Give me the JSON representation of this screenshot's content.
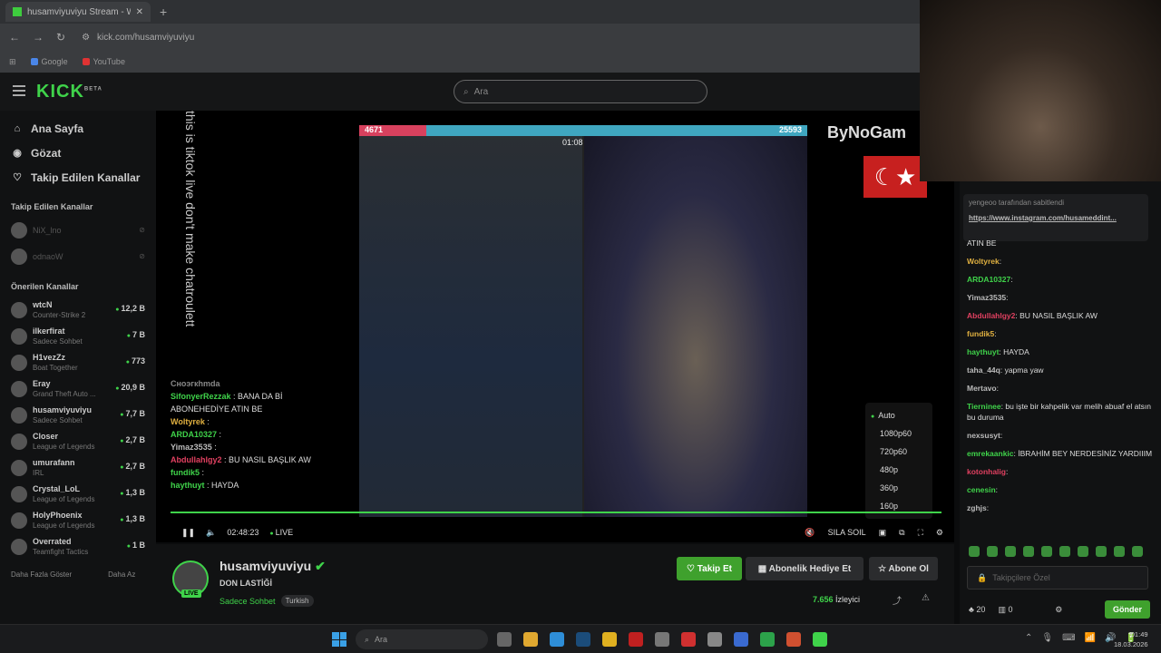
{
  "browser": {
    "tab_title": "husamviyuviyu Stream - W",
    "tab_close": "✕",
    "new_tab": "+",
    "back": "←",
    "forward": "→",
    "reload": "↻",
    "url": "kick.com/husamviyuviyu",
    "apps": "⊞",
    "bookmarks": [
      {
        "label": "Google",
        "color": "#4a86e8"
      },
      {
        "label": "YouTube",
        "color": "#e03333"
      }
    ]
  },
  "header": {
    "logo": "KICK",
    "beta": "BETA",
    "search_icon": "⌕",
    "search_placeholder": "Ara"
  },
  "sidebar": {
    "nav": [
      {
        "icon": "⌂",
        "label": "Ana Sayfa"
      },
      {
        "icon": "◉",
        "label": "Gözat"
      },
      {
        "icon": "♡",
        "label": "Takip Edilen Kanallar"
      }
    ],
    "followed_title": "Takip Edilen Kanallar",
    "followed": [
      {
        "name": "NiX_lno",
        "mute": "⊘"
      },
      {
        "name": "odnaoW",
        "mute": "⊘"
      }
    ],
    "recommended_title": "Önerilen Kanallar",
    "channels": [
      {
        "name": "wtcN",
        "game": "Counter-Strike 2",
        "viewers": "12,2 B"
      },
      {
        "name": "ilkerfirat",
        "game": "Sadece Sohbet",
        "viewers": "7 B"
      },
      {
        "name": "H1vezZz",
        "game": "Boat Together",
        "viewers": "773"
      },
      {
        "name": "Eray",
        "game": "Grand Theft Auto ...",
        "viewers": "20,9 B"
      },
      {
        "name": "husamviyuviyu",
        "game": "Sadece Sohbet",
        "viewers": "7,7 B"
      },
      {
        "name": "Closer",
        "game": "League of Legends",
        "viewers": "2,7 B"
      },
      {
        "name": "umurafann",
        "game": "IRL",
        "viewers": "2,7 B"
      },
      {
        "name": "Crystal_LoL",
        "game": "League of Legends",
        "viewers": "1,3 B"
      },
      {
        "name": "HolyPhoenix",
        "game": "League of Legends",
        "viewers": "1,3 B"
      },
      {
        "name": "Overrated",
        "game": "Teamfight Tactics",
        "viewers": "1 B"
      }
    ],
    "more": "Daha Fazla Göster",
    "less": "Daha Az"
  },
  "player": {
    "vertical_text": "this is tiktok live don't make chatroulett",
    "score_left": "4671",
    "score_right": "25593",
    "timer": "01:08",
    "brand": "ByNoGam",
    "flag": "☾★",
    "overlay_chat": [
      {
        "user": "Сноэгкhmda",
        "msg": "",
        "color": "#888"
      },
      {
        "user": "SifonyerRezzak",
        "msg": " : BANA DA Bİ ABONEHEDİYE ATIN BE",
        "color": "#3fd34a"
      },
      {
        "user": "Woltyrek",
        "msg": " :",
        "color": "#e0b040"
      },
      {
        "user": "ARDA10327",
        "msg": " :",
        "color": "#3fd34a"
      },
      {
        "user": "Yimaz3535",
        "msg": " :",
        "color": "#bbb"
      },
      {
        "user": "Abdullahlgy2",
        "msg": " : BU NASIL BAŞLIK AW",
        "color": "#e04060"
      },
      {
        "user": "fundik5",
        "msg": " :",
        "color": "#3fd34a"
      },
      {
        "user": "haythuyt",
        "msg": " : HAYDA",
        "color": "#3fd34a"
      }
    ],
    "qualities": [
      "Auto",
      "1080p60",
      "720p60",
      "480p",
      "360p",
      "160p"
    ],
    "play_icon": "❚❚",
    "volume_icon": "🔈",
    "time": "02:48:23",
    "live": "LIVE",
    "mute_icon": "🔇",
    "mute_label": "SILA SOIL",
    "theater_icon": "▣",
    "pip_icon": "⧉",
    "fullscreen_icon": "⛶",
    "settings_icon": "⚙"
  },
  "stream": {
    "live": "LIVE",
    "name": "husamviyuviyu",
    "verified": "✔",
    "title": "DON LASTİĞİ",
    "category": "Sadece Sohbet",
    "tag": "Turkish",
    "follow": "♡ Takip Et",
    "gift": "▦ Abonelik Hediye Et",
    "subscribe": "☆ Abone Ol",
    "viewers_count": "7.656",
    "viewers_label": "İzleyici",
    "share_icon": "⤴",
    "report_icon": "⚠"
  },
  "chat": {
    "pinned_by": "yengeoo tarafından sabitlendi",
    "pinned_link": "https://www.instagram.com/husameddint...",
    "messages": [
      {
        "user": "",
        "msg": "ATIN BE",
        "color": "#ccc"
      },
      {
        "user": "Woltyrek",
        "msg": ":",
        "color": "#e0b040"
      },
      {
        "user": "ARDA10327",
        "msg": ":",
        "color": "#3fd34a"
      },
      {
        "user": "Yimaz3535",
        "msg": ":",
        "color": "#bbb"
      },
      {
        "user": "Abdullahlgy2",
        "msg": ": BU NASIL BAŞLIK AW",
        "color": "#e04060"
      },
      {
        "user": "fundik5",
        "msg": ":",
        "color": "#e0b040"
      },
      {
        "user": "haythuyt",
        "msg": ": HAYDA",
        "color": "#3fd34a"
      },
      {
        "user": "taha_44q",
        "msg": ": yapma yaw",
        "color": "#bbb"
      },
      {
        "user": "Mertavo",
        "msg": ":",
        "color": "#bbb"
      },
      {
        "user": "Tierninee",
        "msg": ": bu işte bir kahpelik var melih abuaf el atsın bu duruma",
        "color": "#3fd34a"
      },
      {
        "user": "nexsusyt",
        "msg": ":",
        "color": "#bbb"
      },
      {
        "user": "emrekaankic",
        "msg": ": İBRAHİM BEY NERDESİNİZ YARDIIIM",
        "color": "#3fd34a"
      },
      {
        "user": "kotonhalig",
        "msg": ":",
        "color": "#e04060"
      },
      {
        "user": "cenesin",
        "msg": ":",
        "color": "#3fd34a"
      },
      {
        "user": "zghjs",
        "msg": ":",
        "color": "#bbb"
      }
    ],
    "input_placeholder": "Takipçilere Özel",
    "points": "20",
    "gifts": "0",
    "send": "Gönder"
  },
  "taskbar": {
    "search": "Ara",
    "time": "01:49",
    "date": "18.03.2026",
    "tray": [
      "⌃",
      "🎙",
      "⌨",
      "📶",
      "🔊",
      "🔋"
    ]
  }
}
